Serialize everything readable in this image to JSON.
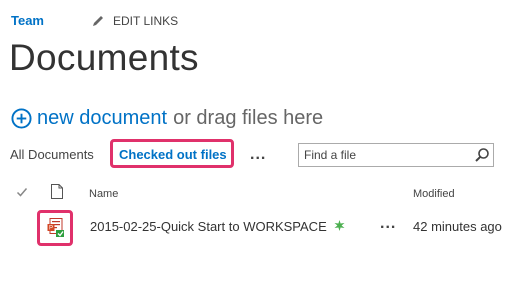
{
  "header": {
    "site_link": "Team",
    "edit_links": "EDIT LINKS"
  },
  "page": {
    "title": "Documents"
  },
  "toolbar": {
    "new_document": "new document",
    "drag_text": "or drag files here"
  },
  "views": {
    "all_documents": "All Documents",
    "checked_out": "Checked out files",
    "more": "..."
  },
  "search": {
    "placeholder": "Find a file"
  },
  "table": {
    "columns": {
      "name": "Name",
      "modified": "Modified"
    },
    "rows": [
      {
        "name": "2015-02-25-Quick Start to WORKSPACE",
        "modified": "42 minutes ago",
        "more": "...",
        "icon": "powerpoint-file-icon",
        "is_new": true
      }
    ]
  },
  "colors": {
    "accent": "#0072c6",
    "highlight": "#e0316b",
    "new_badge": "#4caf50"
  }
}
